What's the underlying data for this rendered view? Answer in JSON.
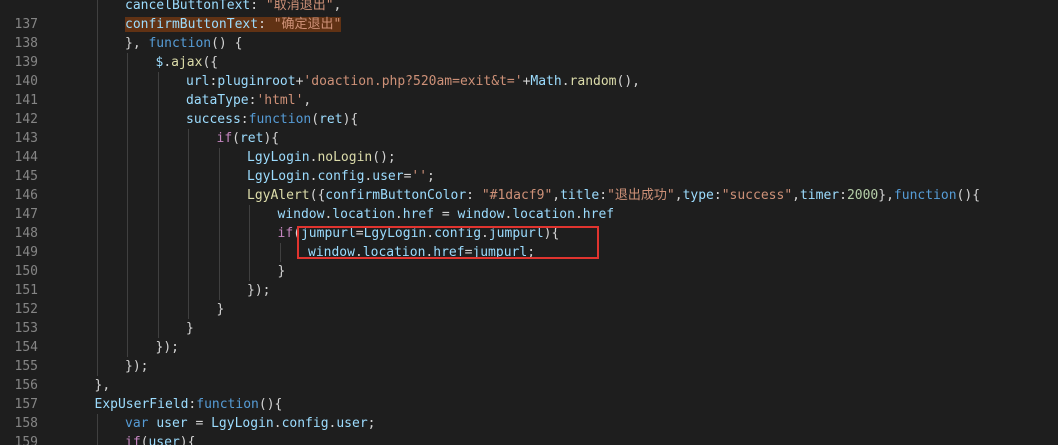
{
  "editor": {
    "colors": {
      "background": "#1e1e1e",
      "line_number": "#858585",
      "highlight_box": "#e0342f"
    },
    "lines": [
      {
        "n": "",
        "indent": 2,
        "tokens": [
          [
            "cancelButtonText",
            "t-prop"
          ],
          [
            ": ",
            "t-punc"
          ],
          [
            "\"取消退出\"",
            "t-str"
          ],
          [
            ",",
            "t-punc"
          ]
        ]
      },
      {
        "n": "137",
        "indent": 2,
        "tokens": [
          [
            "confirmButtonText",
            "t-prop t-hl"
          ],
          [
            ": ",
            "t-punc t-hl"
          ],
          [
            "\"确定退出\"",
            "t-str t-hl"
          ]
        ]
      },
      {
        "n": "138",
        "indent": 2,
        "tokens": [
          [
            "}, ",
            "t-punc"
          ],
          [
            "function",
            "t-kw"
          ],
          [
            "() {",
            "t-punc"
          ]
        ]
      },
      {
        "n": "139",
        "indent": 3,
        "tokens": [
          [
            "$",
            "t-prop"
          ],
          [
            ".",
            "t-punc"
          ],
          [
            "ajax",
            "t-fn"
          ],
          [
            "({",
            "t-punc"
          ]
        ]
      },
      {
        "n": "140",
        "indent": 4,
        "tokens": [
          [
            "url",
            "t-prop"
          ],
          [
            ":",
            "t-punc"
          ],
          [
            "pluginroot",
            "t-prop"
          ],
          [
            "+",
            "t-punc"
          ],
          [
            "'doaction.php?520am=exit&t='",
            "t-str"
          ],
          [
            "+",
            "t-punc"
          ],
          [
            "Math",
            "t-prop"
          ],
          [
            ".",
            "t-punc"
          ],
          [
            "random",
            "t-fn"
          ],
          [
            "(),",
            "t-punc"
          ]
        ]
      },
      {
        "n": "141",
        "indent": 4,
        "tokens": [
          [
            "dataType",
            "t-prop"
          ],
          [
            ":",
            "t-punc"
          ],
          [
            "'html'",
            "t-str"
          ],
          [
            ",",
            "t-punc"
          ]
        ]
      },
      {
        "n": "142",
        "indent": 4,
        "tokens": [
          [
            "success",
            "t-prop"
          ],
          [
            ":",
            "t-punc"
          ],
          [
            "function",
            "t-kw"
          ],
          [
            "(",
            "t-punc"
          ],
          [
            "ret",
            "t-prop"
          ],
          [
            "){",
            "t-punc"
          ]
        ]
      },
      {
        "n": "143",
        "indent": 5,
        "tokens": [
          [
            "if",
            "t-ctl"
          ],
          [
            "(",
            "t-punc"
          ],
          [
            "ret",
            "t-prop"
          ],
          [
            "){",
            "t-punc"
          ]
        ]
      },
      {
        "n": "144",
        "indent": 6,
        "tokens": [
          [
            "LgyLogin",
            "t-prop"
          ],
          [
            ".",
            "t-punc"
          ],
          [
            "noLogin",
            "t-fn"
          ],
          [
            "();",
            "t-punc"
          ]
        ]
      },
      {
        "n": "145",
        "indent": 6,
        "tokens": [
          [
            "LgyLogin",
            "t-prop"
          ],
          [
            ".",
            "t-punc"
          ],
          [
            "config",
            "t-prop"
          ],
          [
            ".",
            "t-punc"
          ],
          [
            "user",
            "t-prop"
          ],
          [
            "=",
            "t-punc"
          ],
          [
            "''",
            "t-str"
          ],
          [
            ";",
            "t-punc"
          ]
        ]
      },
      {
        "n": "146",
        "indent": 6,
        "tokens": [
          [
            "LgyAlert",
            "t-fn"
          ],
          [
            "({",
            "t-punc"
          ],
          [
            "confirmButtonColor",
            "t-prop"
          ],
          [
            ": ",
            "t-punc"
          ],
          [
            "\"#1dacf9\"",
            "t-str"
          ],
          [
            ",",
            "t-punc"
          ],
          [
            "title",
            "t-prop"
          ],
          [
            ":",
            "t-punc"
          ],
          [
            "\"退出成功\"",
            "t-str"
          ],
          [
            ",",
            "t-punc"
          ],
          [
            "type",
            "t-prop"
          ],
          [
            ":",
            "t-punc"
          ],
          [
            "\"success\"",
            "t-str"
          ],
          [
            ",",
            "t-punc"
          ],
          [
            "timer",
            "t-prop"
          ],
          [
            ":",
            "t-punc"
          ],
          [
            "2000",
            "t-num"
          ],
          [
            "},",
            "t-punc"
          ],
          [
            "function",
            "t-kw"
          ],
          [
            "(){",
            "t-punc"
          ]
        ]
      },
      {
        "n": "147",
        "indent": 7,
        "tokens": [
          [
            "window",
            "t-prop"
          ],
          [
            ".",
            "t-punc"
          ],
          [
            "location",
            "t-prop"
          ],
          [
            ".",
            "t-punc"
          ],
          [
            "href",
            "t-prop"
          ],
          [
            " = ",
            "t-punc"
          ],
          [
            "window",
            "t-prop"
          ],
          [
            ".",
            "t-punc"
          ],
          [
            "location",
            "t-prop"
          ],
          [
            ".",
            "t-punc"
          ],
          [
            "href",
            "t-prop"
          ]
        ]
      },
      {
        "n": "148",
        "indent": 7,
        "tokens": [
          [
            "if",
            "t-ctl"
          ],
          [
            "(",
            "t-punc"
          ],
          [
            "jumpurl",
            "t-prop"
          ],
          [
            "=",
            "t-punc"
          ],
          [
            "LgyLogin",
            "t-prop"
          ],
          [
            ".",
            "t-punc"
          ],
          [
            "config",
            "t-prop"
          ],
          [
            ".",
            "t-punc"
          ],
          [
            "jumpurl",
            "t-prop"
          ],
          [
            "){",
            "t-punc"
          ]
        ]
      },
      {
        "n": "149",
        "indent": 8,
        "tokens": [
          [
            "window",
            "t-prop"
          ],
          [
            ".",
            "t-punc"
          ],
          [
            "location",
            "t-prop"
          ],
          [
            ".",
            "t-punc"
          ],
          [
            "href",
            "t-prop"
          ],
          [
            "=",
            "t-punc"
          ],
          [
            "jumpurl",
            "t-prop"
          ],
          [
            ";",
            "t-punc"
          ]
        ]
      },
      {
        "n": "150",
        "indent": 7,
        "tokens": [
          [
            "}",
            "t-punc"
          ]
        ]
      },
      {
        "n": "151",
        "indent": 6,
        "tokens": [
          [
            "});",
            "t-punc"
          ]
        ]
      },
      {
        "n": "152",
        "indent": 5,
        "tokens": [
          [
            "}",
            "t-punc"
          ]
        ]
      },
      {
        "n": "153",
        "indent": 4,
        "tokens": [
          [
            "}",
            "t-punc"
          ]
        ]
      },
      {
        "n": "154",
        "indent": 3,
        "tokens": [
          [
            "});",
            "t-punc"
          ]
        ]
      },
      {
        "n": "155",
        "indent": 2,
        "tokens": [
          [
            "});",
            "t-punc"
          ]
        ]
      },
      {
        "n": "156",
        "indent": 1,
        "tokens": [
          [
            "},",
            "t-punc"
          ]
        ]
      },
      {
        "n": "157",
        "indent": 1,
        "tokens": [
          [
            "ExpUserField",
            "t-prop"
          ],
          [
            ":",
            "t-punc"
          ],
          [
            "function",
            "t-kw"
          ],
          [
            "(){",
            "t-punc"
          ]
        ]
      },
      {
        "n": "158",
        "indent": 2,
        "tokens": [
          [
            "var",
            "t-kw"
          ],
          [
            " ",
            "t-punc"
          ],
          [
            "user",
            "t-prop"
          ],
          [
            " = ",
            "t-punc"
          ],
          [
            "LgyLogin",
            "t-prop"
          ],
          [
            ".",
            "t-punc"
          ],
          [
            "config",
            "t-prop"
          ],
          [
            ".",
            "t-punc"
          ],
          [
            "user",
            "t-prop"
          ],
          [
            ";",
            "t-punc"
          ]
        ]
      },
      {
        "n": "159",
        "indent": 2,
        "tokens": [
          [
            "if",
            "t-ctl"
          ],
          [
            "(",
            "t-punc"
          ],
          [
            "user",
            "t-prop"
          ],
          [
            "){",
            "t-punc"
          ]
        ]
      }
    ]
  }
}
